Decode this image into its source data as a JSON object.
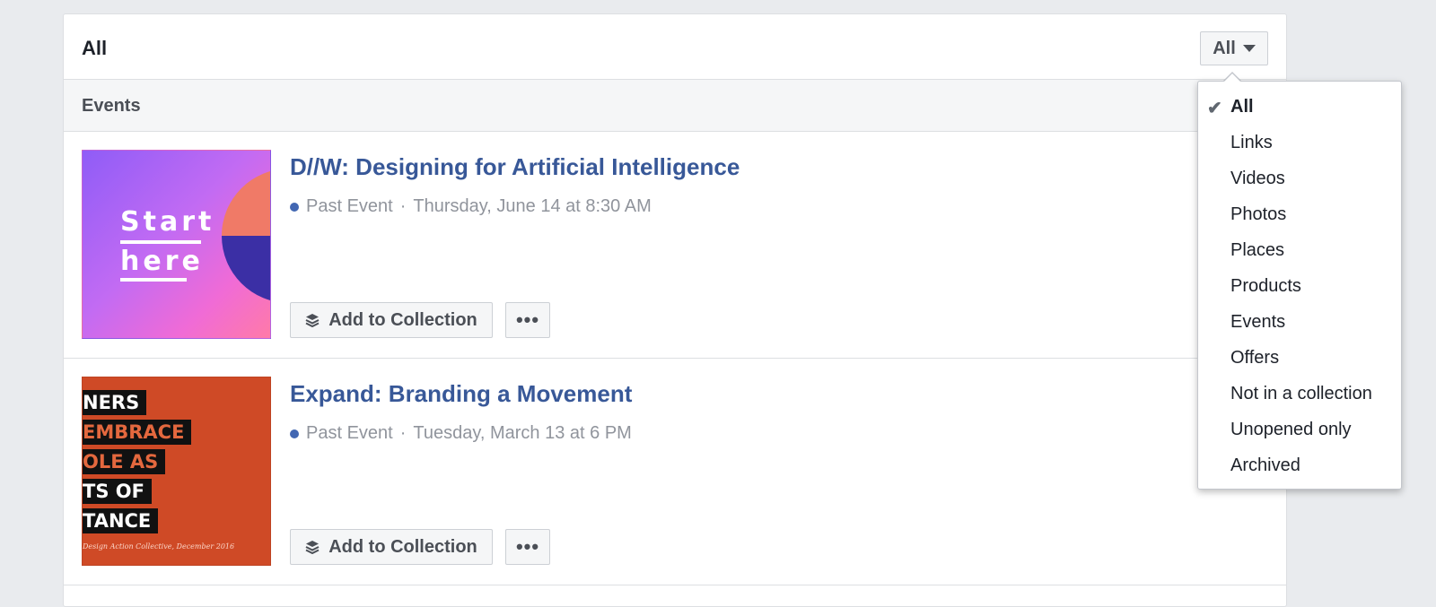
{
  "header": {
    "title": "All",
    "filter_label": "All"
  },
  "section": {
    "title": "Events"
  },
  "events": [
    {
      "title": "D//W: Designing for Artificial Intelligence",
      "status": "Past Event",
      "separator": "·",
      "date": "Thursday, June 14 at 8:30 AM",
      "thumb_text": [
        "Start",
        "here"
      ]
    },
    {
      "title": "Expand: Branding a Movement",
      "status": "Past Event",
      "separator": "·",
      "date": "Tuesday, March 13 at 6 PM",
      "thumb_text": [
        "NERS",
        "EMBRACE",
        "OLE AS",
        "TS OF",
        "TANCE"
      ],
      "thumb_footer": "Design Action Collective, December 2016"
    }
  ],
  "actions": {
    "add_to_collection": "Add to Collection",
    "more": "•••"
  },
  "dropdown": {
    "selected": "All",
    "items": [
      "All",
      "Links",
      "Videos",
      "Photos",
      "Places",
      "Products",
      "Events",
      "Offers",
      "Not in a collection",
      "Unopened only",
      "Archived"
    ]
  },
  "colors": {
    "link": "#385898",
    "status_dot": "#4267b2",
    "background": "#e9ebee"
  },
  "icons": {
    "check": "check-icon",
    "caret": "caret-down-icon",
    "collection": "collection-stack-icon",
    "more": "more-options-icon"
  }
}
